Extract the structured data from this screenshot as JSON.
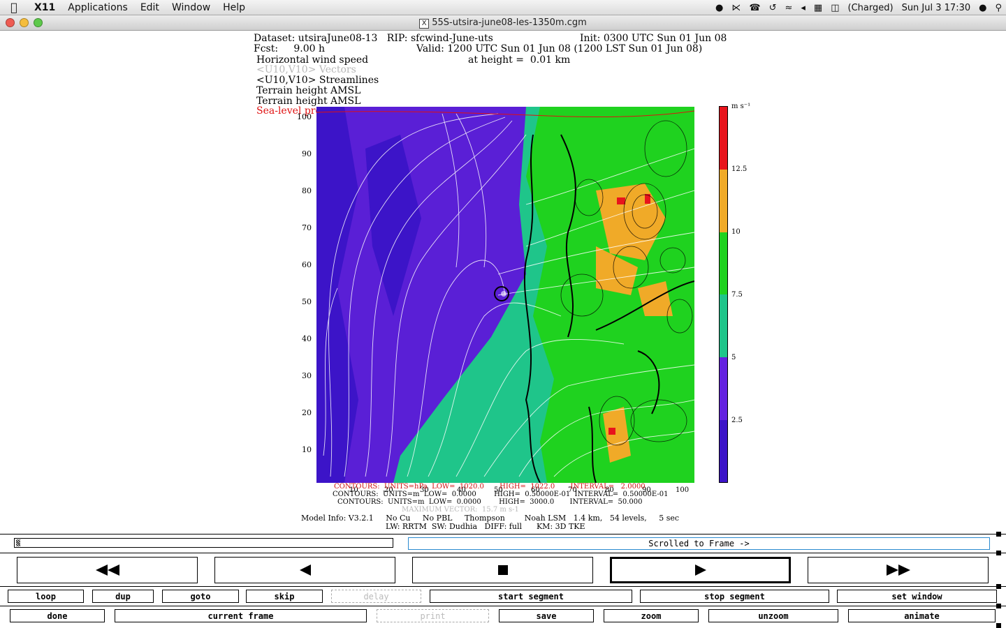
{
  "menubar": {
    "app": "X11",
    "items": [
      "Applications",
      "Edit",
      "Window",
      "Help"
    ],
    "battery": "(Charged)",
    "clock": "Sun Jul 3  17:30"
  },
  "window": {
    "title": "55S-utsira-june08-les-1350m.cgm"
  },
  "plot_header": {
    "line1_left": "Dataset: utsiraJune08-13   RIP: sfcwind-June-uts",
    "line1_right": "Init: 0300 UTC Sun 01 Jun 08",
    "line2_left": "Fcst:     9.00 h",
    "line2_right": "Valid: 1200 UTC Sun 01 Jun 08 (1200 LST Sun 01 Jun 08)",
    "line3_left": "Horizontal wind speed",
    "line3_right": "at height =  0.01 km",
    "vectors": "<U10,V10> Vectors",
    "streamlines": "<U10,V10> Streamlines",
    "terrain1": "Terrain height AMSL",
    "terrain2": "Terrain height AMSL",
    "slp": "Sea-level pressure"
  },
  "chart_data": {
    "type": "heatmap",
    "y_ticks": [
      "100",
      "90",
      "80",
      "70",
      "60",
      "50",
      "40",
      "30",
      "20",
      "10"
    ],
    "x_ticks": [
      "10",
      "20",
      "30",
      "40",
      "50",
      "60",
      "70",
      "80",
      "90",
      "100"
    ],
    "colorbar_unit": "m s⁻¹",
    "colorbar_labels": [
      "12.5",
      "10",
      "7.5",
      "5",
      "2.5"
    ],
    "colorbar_colors": [
      "#e8141c",
      "#f0aa28",
      "#1fd21f",
      "#1fc58a",
      "#6422e0",
      "#3c14c8"
    ]
  },
  "footer": {
    "contour1": "CONTOURS:  UNITS=hPa  LOW=  1020.0       HIGH=  1022.0       INTERVAL=   2.0000",
    "contour2": "CONTOURS:  UNITS=m  LOW=  0.0000        HIGH=  0.50000E-01  INTERVAL=  0.50000E-01",
    "contour3": "CONTOURS:  UNITS=m  LOW=  0.0000        HIGH=  3000.0       INTERVAL=  50.000",
    "max_vector": "MAXIMUM VECTOR:  15.7 m s-1",
    "model_info": "Model Info: V3.2.1     No Cu     No PBL     Thompson        Noah LSM   1.4 km,   54 levels,     5 sec",
    "model_info2": "LW: RRTM  SW: Dudhia   DIFF: full      KM: 3D TKE"
  },
  "controls": {
    "status": "Scrolled to Frame ->",
    "row1": [
      "loop",
      "dup",
      "goto",
      "skip",
      "delay",
      "start segment",
      "stop segment",
      "set window"
    ],
    "row2": [
      "done",
      "current frame",
      "print",
      "save",
      "zoom",
      "unzoom",
      "animate"
    ]
  }
}
